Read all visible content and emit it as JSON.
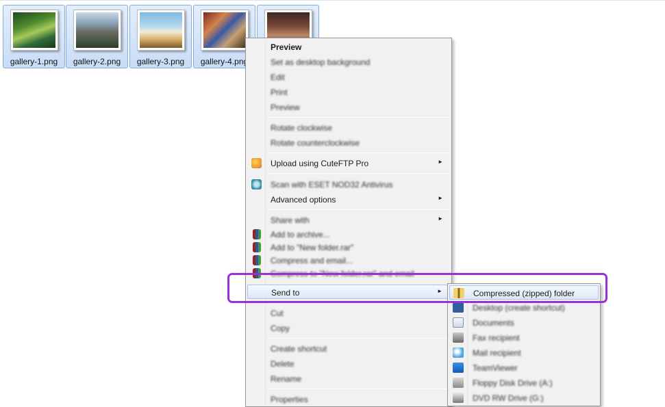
{
  "thumbnails": [
    {
      "name": "gallery-1.png"
    },
    {
      "name": "gallery-2.png"
    },
    {
      "name": "gallery-3.png"
    },
    {
      "name": "gallery-4.png"
    },
    {
      "name": ""
    }
  ],
  "context_menu": {
    "items": [
      {
        "label": "Preview",
        "bold": true
      },
      {
        "label": "Set as desktop background"
      },
      {
        "label": "Edit"
      },
      {
        "label": "Print"
      },
      {
        "label": "Preview"
      },
      {
        "label": "Rotate clockwise"
      },
      {
        "label": "Rotate counterclockwise"
      },
      {
        "label": "Upload using CuteFTP Pro",
        "icon": "cuteftp-icon",
        "submenu": true
      },
      {
        "label": "Scan with ESET NOD32 Antivirus",
        "icon": "eset-icon"
      },
      {
        "label": "Advanced options",
        "submenu": true
      },
      {
        "label": "Share with",
        "submenu": true
      },
      {
        "label": "Add to archive...",
        "icon": "winrar-icon"
      },
      {
        "label": "Add to \"New folder.rar\"",
        "icon": "winrar-icon"
      },
      {
        "label": "Compress and email...",
        "icon": "winrar-icon"
      },
      {
        "label": "Compress to \"New folder.rar\" and email",
        "icon": "winrar-icon"
      },
      {
        "label": "Send to",
        "submenu": true,
        "highlighted": true
      },
      {
        "label": "Cut"
      },
      {
        "label": "Copy"
      },
      {
        "label": "Create shortcut"
      },
      {
        "label": "Delete"
      },
      {
        "label": "Rename"
      },
      {
        "label": "Properties"
      }
    ],
    "submenu_arrow": "►"
  },
  "send_to_submenu": {
    "items": [
      {
        "label": "Compressed (zipped) folder",
        "icon": "zip-folder-icon",
        "highlighted": true
      },
      {
        "label": "Desktop (create shortcut)",
        "icon": "desktop-icon"
      },
      {
        "label": "Documents",
        "icon": "documents-icon"
      },
      {
        "label": "Fax recipient",
        "icon": "fax-icon"
      },
      {
        "label": "Mail recipient",
        "icon": "mail-icon"
      },
      {
        "label": "TeamViewer",
        "icon": "teamviewer-icon"
      },
      {
        "label": "Floppy Disk Drive (A:)",
        "icon": "floppy-icon"
      },
      {
        "label": "DVD RW Drive (G:)",
        "icon": "dvd-icon"
      }
    ]
  },
  "colors": {
    "selection_border": "#84acdd",
    "menu_background": "#f1f1f1",
    "highlight_annotation": "#9b30d9"
  }
}
